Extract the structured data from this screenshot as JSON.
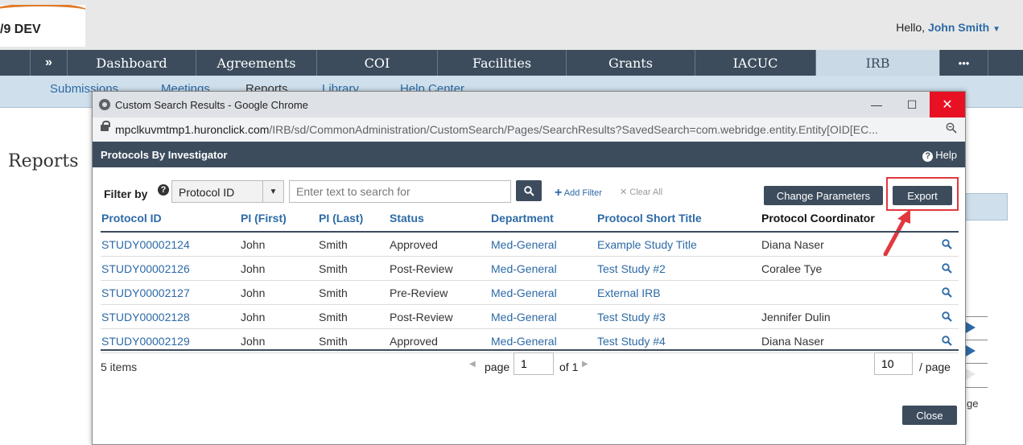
{
  "app": {
    "logo_text": "/9 DEV",
    "greeting": "Hello,",
    "user_name": "John Smith",
    "nav": [
      "»",
      "Dashboard",
      "Agreements",
      "COI",
      "Facilities",
      "Grants",
      "IACUC",
      "IRB",
      "•••"
    ],
    "active_nav": "IRB",
    "subnav": [
      "Submissions",
      "Meetings",
      "Reports",
      "Library",
      "Help Center"
    ],
    "page_heading": "Reports",
    "partial_text": "ge"
  },
  "window": {
    "title": "Custom Search Results - Google Chrome",
    "url_host": "mpclkuvmtmp1.huronclick.com",
    "url_path": "/IRB/sd/CommonAdministration/CustomSearch/Pages/SearchResults?SavedSearch=com.webridge.entity.Entity[OID[EC...",
    "minimize": "—",
    "maximize": "☐",
    "close": "✕"
  },
  "dialog": {
    "title": "Protocols By Investigator",
    "help": "Help",
    "filter_label": "Filter by",
    "filter_field": "Protocol ID",
    "search_placeholder": "Enter text to search for",
    "add_filter": "Add Filter",
    "clear_all": "✕ Clear All",
    "change_parameters": "Change Parameters",
    "export": "Export",
    "close": "Close"
  },
  "table": {
    "columns": [
      "Protocol ID",
      "PI (First)",
      "PI (Last)",
      "Status",
      "Department",
      "Protocol Short Title",
      "Protocol Coordinator"
    ],
    "rows": [
      [
        "STUDY00002124",
        "John",
        "Smith",
        "Approved",
        "Med-General",
        "Example Study Title",
        "Diana Naser"
      ],
      [
        "STUDY00002126",
        "John",
        "Smith",
        "Post-Review",
        "Med-General",
        "Test Study #2",
        "Coralee Tye"
      ],
      [
        "STUDY00002127",
        "John",
        "Smith",
        "Pre-Review",
        "Med-General",
        "External IRB",
        ""
      ],
      [
        "STUDY00002128",
        "John",
        "Smith",
        "Post-Review",
        "Med-General",
        "Test Study #3",
        "Jennifer Dulin"
      ],
      [
        "STUDY00002129",
        "John",
        "Smith",
        "Approved",
        "Med-General",
        "Test Study #4",
        "Diana Naser"
      ]
    ]
  },
  "pager": {
    "items": "5 items",
    "page_label": "page",
    "page_value": "1",
    "of_label": "of 1",
    "per_page_value": "10",
    "per_page_label": "/ page"
  },
  "colors": {
    "nav_bg": "#3c4c5d",
    "link": "#2d6aa6",
    "highlight": "#e0383e"
  }
}
